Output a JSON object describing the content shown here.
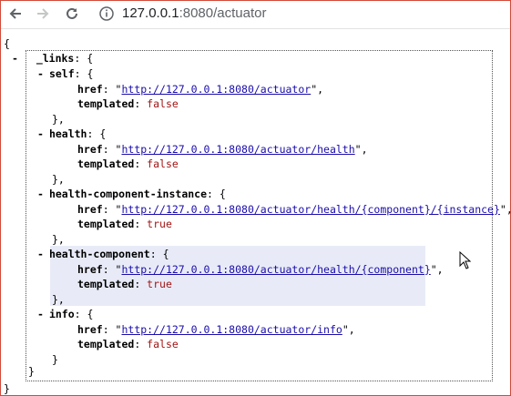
{
  "browser": {
    "url_host": "127.0.0.1",
    "url_rest": ":8080/actuator"
  },
  "json_view": {
    "open_brace": "{",
    "close_brace": "}",
    "links_key": "_links",
    "entries": [
      {
        "key": "self",
        "href": "http://127.0.0.1:8080/actuator",
        "templated": "false"
      },
      {
        "key": "health",
        "href": "http://127.0.0.1:8080/actuator/health",
        "templated": "false"
      },
      {
        "key": "health-component-instance",
        "href": "http://127.0.0.1:8080/actuator/health/{component}/{instance}",
        "templated": "true"
      },
      {
        "key": "health-component",
        "href": "http://127.0.0.1:8080/actuator/health/{component}",
        "templated": "true"
      },
      {
        "key": "info",
        "href": "http://127.0.0.1:8080/actuator/info",
        "templated": "false"
      }
    ],
    "labels": {
      "toggle": "-",
      "href": "href",
      "templated": "templated"
    },
    "colors": {
      "link": "#1a0dab",
      "bool": "#a31515",
      "highlight": "#e8ebf7"
    }
  }
}
